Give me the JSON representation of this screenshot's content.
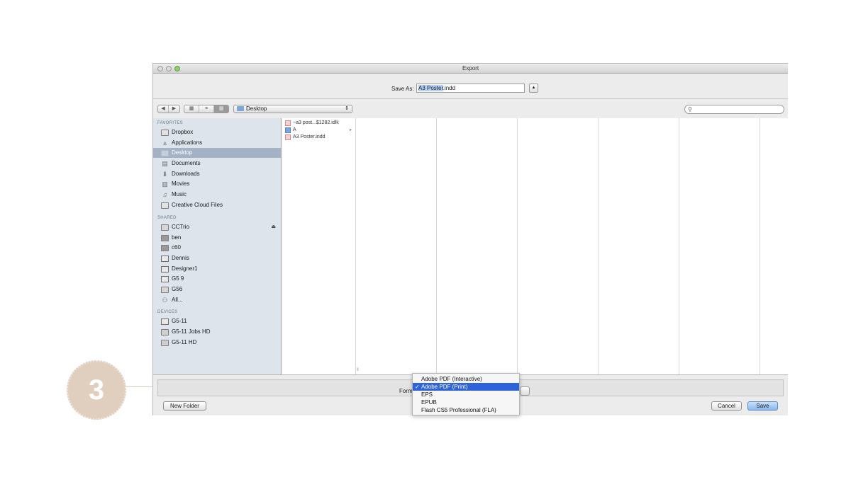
{
  "window": {
    "title": "Export"
  },
  "save_as": {
    "label": "Save As:",
    "value_selected": "A3 Poster",
    "value_rest": ".indd"
  },
  "toolbar": {
    "nav": [
      "◀",
      "▶"
    ],
    "views": [
      "▦",
      "≡",
      "▥"
    ],
    "location": "Desktop",
    "location_arrow": "⇕",
    "search_placeholder": "",
    "search_icon": "🔍"
  },
  "sidebar": {
    "favorites_header": "FAVORITES",
    "favorites": [
      {
        "label": "Dropbox",
        "icon": "folder-icon"
      },
      {
        "label": "Applications",
        "icon": "applications-icon"
      },
      {
        "label": "Desktop",
        "icon": "desktop-icon",
        "selected": true
      },
      {
        "label": "Documents",
        "icon": "documents-icon"
      },
      {
        "label": "Downloads",
        "icon": "downloads-icon"
      },
      {
        "label": "Movies",
        "icon": "movies-icon"
      },
      {
        "label": "Music",
        "icon": "music-icon"
      },
      {
        "label": "Creative Cloud Files",
        "icon": "folder-icon"
      }
    ],
    "shared_header": "SHARED",
    "shared": [
      {
        "label": "CCTrio",
        "icon": "server-icon",
        "eject": "⏏"
      },
      {
        "label": "ben",
        "icon": "computer-icon"
      },
      {
        "label": "c60",
        "icon": "computer-icon"
      },
      {
        "label": "Dennis",
        "icon": "monitor-icon"
      },
      {
        "label": "Designer1",
        "icon": "monitor-icon"
      },
      {
        "label": "G5 9",
        "icon": "monitor-icon"
      },
      {
        "label": "G56",
        "icon": "server-icon"
      },
      {
        "label": "All...",
        "icon": "network-icon"
      }
    ],
    "devices_header": "DEVICES",
    "devices": [
      {
        "label": "G5-11",
        "icon": "monitor-icon"
      },
      {
        "label": "G5-11 Jobs HD",
        "icon": "drive-icon"
      },
      {
        "label": "G5-11 HD",
        "icon": "drive-icon"
      }
    ]
  },
  "files": [
    {
      "name": "~a3 post...$1282.idlk",
      "type": "document"
    },
    {
      "name": "A",
      "type": "folder",
      "chevron": "▸"
    },
    {
      "name": "A3 Poster.indd",
      "type": "document"
    }
  ],
  "format": {
    "label": "Forma",
    "options": [
      {
        "label": "Adobe PDF (Interactive)"
      },
      {
        "label": "Adobe PDF (Print)",
        "selected": true,
        "check": "✓"
      },
      {
        "label": "EPS"
      },
      {
        "label": "EPUB"
      },
      {
        "label": "Flash CS5 Professional (FLA)"
      }
    ]
  },
  "buttons": {
    "new_folder": "New Folder",
    "cancel": "Cancel",
    "save": "Save"
  },
  "callout": {
    "step": "3"
  }
}
